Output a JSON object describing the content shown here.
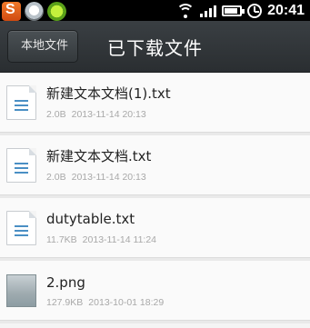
{
  "status_bar": {
    "time": "20:41",
    "icons": [
      "sogou-icon",
      "cloud-app-icon",
      "green-app-icon",
      "wifi-icon",
      "signal-icon",
      "battery-icon",
      "alarm-icon"
    ]
  },
  "header": {
    "back_label": "本地文件",
    "title": "已下载文件"
  },
  "files": [
    {
      "name": "新建文本文档(1).txt",
      "size": "2.0B",
      "date": "2013-11-14 20:13",
      "icon": "text-file-icon"
    },
    {
      "name": "新建文本文档.txt",
      "size": "2.0B",
      "date": "2013-11-14 20:13",
      "icon": "text-file-icon"
    },
    {
      "name": "dutytable.txt",
      "size": "11.7KB",
      "date": "2013-11-14 11:24",
      "icon": "text-file-icon"
    },
    {
      "name": "2.png",
      "size": "127.9KB",
      "date": "2013-10-01 18:29",
      "icon": "image-thumbnail"
    }
  ],
  "colors": {
    "header_bg": "#30353a",
    "list_bg": "#fafafa",
    "meta_text": "#a8a8a8",
    "file_icon_lines": "#4a8fc4"
  }
}
